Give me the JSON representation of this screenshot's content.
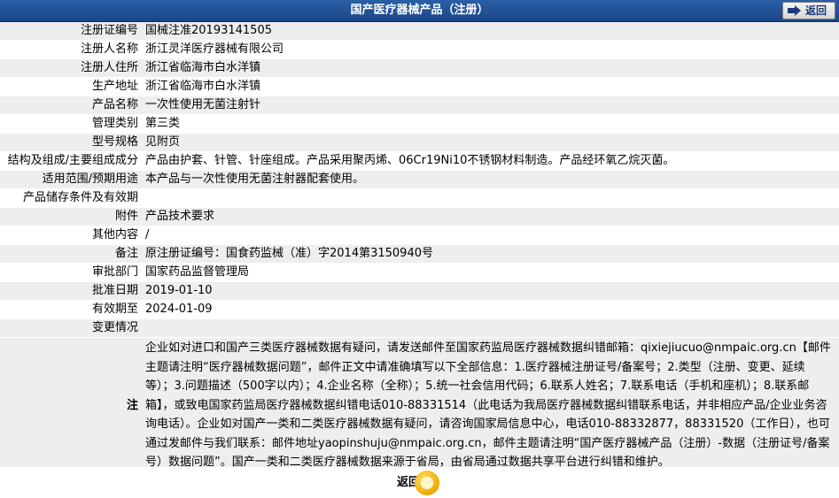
{
  "header": {
    "title": "国产医疗器械产品（注册）",
    "back_label": "返回"
  },
  "fields": [
    {
      "key": "注册证编号",
      "value": "国械注准20193141505"
    },
    {
      "key": "注册人名称",
      "value": "浙江灵洋医疗器械有限公司"
    },
    {
      "key": "注册人住所",
      "value": "浙江省临海市白水洋镇"
    },
    {
      "key": "生产地址",
      "value": "浙江省临海市白水洋镇"
    },
    {
      "key": "产品名称",
      "value": "一次性使用无菌注射针"
    },
    {
      "key": "管理类别",
      "value": "第三类"
    },
    {
      "key": "型号规格",
      "value": "见附页"
    },
    {
      "key": "结构及组成/主要组成成分",
      "value": "产品由护套、针管、针座组成。产品采用聚丙烯、06Cr19Ni10不锈钢材料制造。产品经环氧乙烷灭菌。"
    },
    {
      "key": "适用范围/预期用途",
      "value": "本产品与一次性使用无菌注射器配套使用。"
    },
    {
      "key": "产品储存条件及有效期",
      "value": ""
    },
    {
      "key": "附件",
      "value": "产品技术要求"
    },
    {
      "key": "其他内容",
      "value": "/"
    },
    {
      "key": "备注",
      "value": "原注册证编号：国食药监械（准）字2014第3150940号"
    },
    {
      "key": "审批部门",
      "value": "国家药品监督管理局"
    },
    {
      "key": "批准日期",
      "value": "2019-01-10"
    },
    {
      "key": "有效期至",
      "value": "2024-01-09"
    },
    {
      "key": "变更情况",
      "value": ""
    }
  ],
  "note": {
    "label": "注",
    "text": "企业如对进口和国产三类医疗器械数据有疑问，请发送邮件至国家药监局医疗器械数据纠错邮箱：qixiejiucuo@nmpaic.org.cn【邮件主题请注明“医疗器械数据问题”，邮件正文中请准确填写以下全部信息：1.医疗器械注册证号/备案号；2.类型（注册、变更、延续等）；3.问题描述（500字以内）；4.企业名称（全称）；5.统一社会信用代码；6.联系人姓名；7.联系电话（手机和座机）；8.联系邮箱】，或致电国家药监局医疗器械数据纠错电话010-88331514（此电话为我局医疗器械数据纠错联系电话，并非相应产品/企业业务咨询电话）。企业如对国产一类和二类医疗器械数据有疑问，请咨询国家局信息中心，电话010-88332877，88331520（工作日），也可通过发邮件与我们联系：邮件地址yaopinshuju@nmpaic.org.cn，邮件主题请注明“国产医疗器械产品（注册）-数据（注册证号/备案号）数据问题”。国产一类和二类医疗器械数据来源于省局，由省局通过数据共享平台进行纠错和维护。"
  },
  "footer": {
    "back_label": "返回"
  },
  "colors": {
    "header_bg": "#1a4687",
    "row_alt": "#eeeeee",
    "accent": "#f0a800"
  }
}
